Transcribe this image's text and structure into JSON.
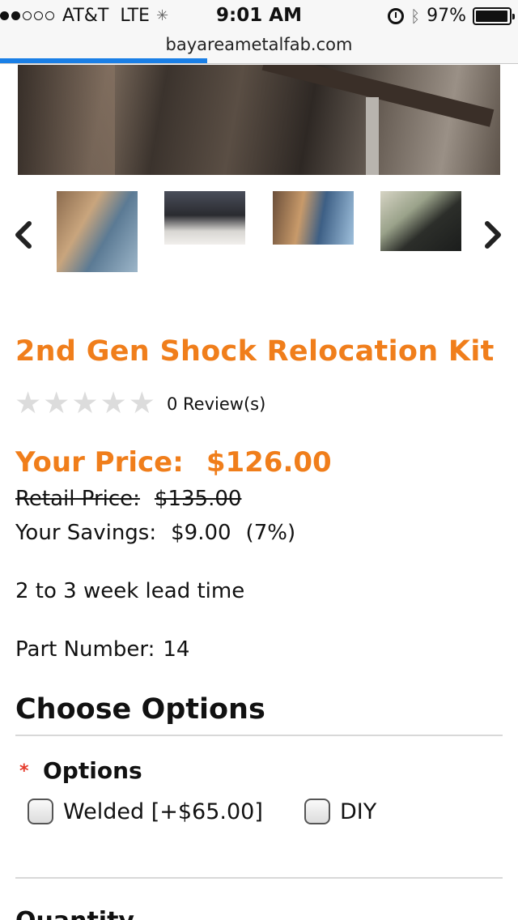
{
  "status_bar": {
    "carrier": "AT&T",
    "network": "LTE",
    "time": "9:01 AM",
    "battery": "97%",
    "battery_level": 0.97
  },
  "browser": {
    "url": "bayareametalfab.com",
    "load_progress": 0.4
  },
  "product": {
    "title": "2nd Gen Shock Relocation Kit",
    "rating": 0,
    "reviews_label": "0 Review(s)",
    "price_label": "Your Price:",
    "price_value": "$126.00",
    "retail_label": "Retail Price:",
    "retail_value": "$135.00",
    "savings_label": "Your Savings:",
    "savings_value": "$9.00",
    "savings_pct": "(7%)",
    "lead_time": "2 to 3 week lead time",
    "part_number_label": "Part Number:",
    "part_number_value": "14"
  },
  "options": {
    "heading": "Choose Options",
    "required_marker": "*",
    "label": "Options",
    "choices": [
      {
        "label": "Welded [+$65.00]",
        "checked": false
      },
      {
        "label": "DIY",
        "checked": false
      }
    ]
  },
  "quantity": {
    "label": "Quantity"
  },
  "colors": {
    "accent": "#f07e1b",
    "required": "#e53b2c",
    "progress": "#1a7fe6"
  }
}
